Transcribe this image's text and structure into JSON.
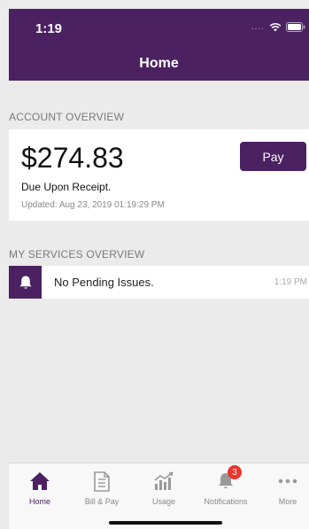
{
  "status_bar": {
    "time": "1:19",
    "signal": "....",
    "colors": {
      "brand": "#4b2162"
    }
  },
  "nav": {
    "title": "Home"
  },
  "account_overview": {
    "header": "ACCOUNT OVERVIEW",
    "amount": "$274.83",
    "pay_label": "Pay",
    "due_text": "Due Upon Receipt.",
    "updated_text": "Updated: Aug 23, 2019 01:19:29 PM"
  },
  "services_overview": {
    "header": "MY SERVICES OVERVIEW",
    "items": [
      {
        "icon": "bell-icon",
        "text": "No Pending Issues.",
        "time": "1:19 PM"
      }
    ]
  },
  "tabbar": {
    "tabs": [
      {
        "label": "Home",
        "icon": "house-icon",
        "active": true
      },
      {
        "label": "Bill & Pay",
        "icon": "bill-document-icon",
        "active": false
      },
      {
        "label": "Usage",
        "icon": "usage-chart-icon",
        "active": false
      },
      {
        "label": "Notifications",
        "icon": "bell-icon",
        "badge": "3",
        "active": false
      },
      {
        "label": "More",
        "icon": "more-dots-icon",
        "active": false
      }
    ]
  }
}
